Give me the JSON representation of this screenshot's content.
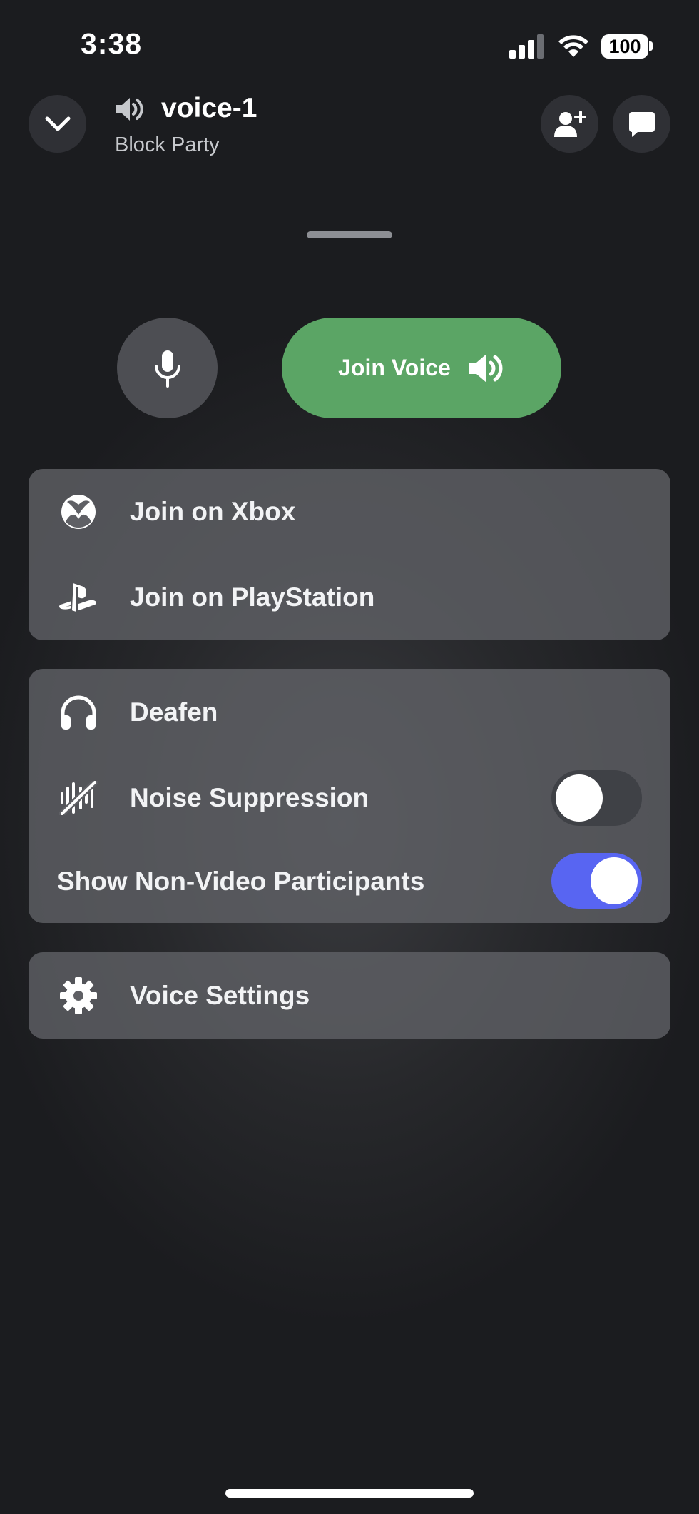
{
  "status_bar": {
    "time": "3:38",
    "battery": "100"
  },
  "header": {
    "channel_name": "voice-1",
    "server_name": "Block Party",
    "icons": [
      "chevron-down-icon",
      "speaker-icon",
      "add-user-icon",
      "chat-bubble-icon"
    ]
  },
  "actions": {
    "join_voice_label": "Join Voice"
  },
  "console_card": {
    "items": [
      {
        "label": "Join on Xbox",
        "icon": "xbox-icon"
      },
      {
        "label": "Join on PlayStation",
        "icon": "playstation-icon"
      }
    ]
  },
  "audio_card": {
    "deafen_label": "Deafen",
    "noise_label": "Noise Suppression",
    "noise_enabled": false,
    "non_video_label": "Show Non-Video Participants",
    "non_video_enabled": true
  },
  "settings_card": {
    "label": "Voice Settings"
  },
  "colors": {
    "background": "#1b1c1f",
    "join_green": "#5ba565",
    "toggle_on": "#5865f2",
    "toggle_off": "#3f4146"
  }
}
